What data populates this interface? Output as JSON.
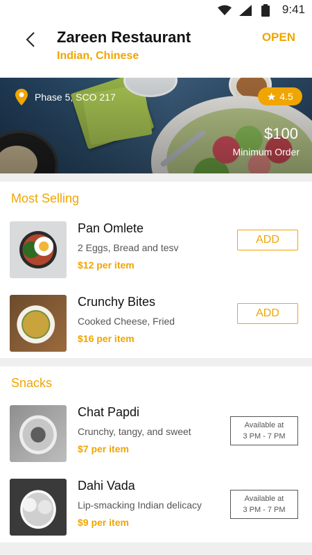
{
  "status_bar": {
    "time": "9:41"
  },
  "header": {
    "title": "Zareen Restaurant",
    "cuisines": "Indian, Chinese",
    "status": "OPEN"
  },
  "hero": {
    "location": "Phase 5, SCO 217",
    "rating": "4.5",
    "min_order_value": "$100",
    "min_order_label": "Minimum Order"
  },
  "most_selling": {
    "title": "Most Selling",
    "items": [
      {
        "name": "Pan Omlete",
        "description": "2 Eggs, Bread and tesv",
        "price": "$12 per item",
        "action": "ADD",
        "image": "omelette-pan"
      },
      {
        "name": "Crunchy Bites",
        "description": "Cooked Cheese, Fried",
        "price": "$16 per item",
        "action": "ADD",
        "image": "curry-plate"
      }
    ]
  },
  "snacks": {
    "title": "Snacks",
    "items": [
      {
        "name": "Chat Papdi",
        "description": "Crunchy, tangy, and sweet",
        "price": "$7 per item",
        "availability_line1": "Available at",
        "availability_line2": "3 PM - 7 PM",
        "image": "chaat-bowl"
      },
      {
        "name": "Dahi Vada",
        "description": "Lip-smacking Indian delicacy",
        "price": "$9 per item",
        "availability_line1": "Available at",
        "availability_line2": "3 PM - 7 PM",
        "image": "dahi-vada-bowl"
      }
    ]
  },
  "colors": {
    "accent": "#f0a500",
    "background": "#efefef"
  }
}
